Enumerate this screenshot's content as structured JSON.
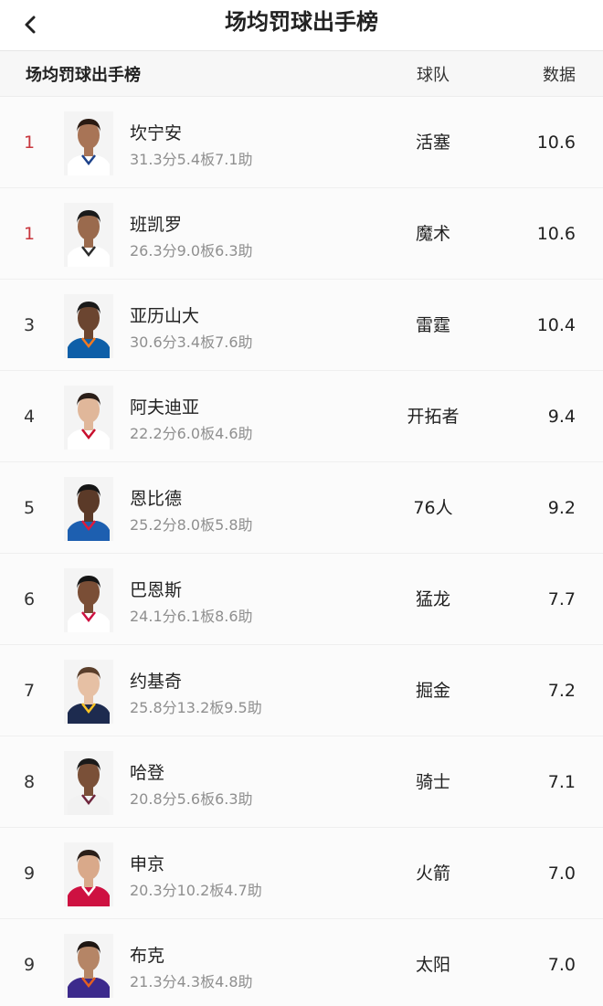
{
  "nav": {
    "title": "场均罚球出手榜"
  },
  "header": {
    "title": "场均罚球出手榜",
    "team_col": "球队",
    "data_col": "数据"
  },
  "accent_color": "#c8363d",
  "rows": [
    {
      "rank": "1",
      "name": "坎宁安",
      "stats": "31.3分5.4板7.1助",
      "team": "活塞",
      "value": "10.6",
      "jersey": "#ffffff",
      "trim": "#1d428a",
      "skin": "#a87456",
      "hair": "#2a1a12"
    },
    {
      "rank": "1",
      "name": "班凯罗",
      "stats": "26.3分9.0板6.3助",
      "team": "魔术",
      "value": "10.6",
      "jersey": "#ffffff",
      "trim": "#2b2b2b",
      "skin": "#9a6a4d",
      "hair": "#1a1a1a"
    },
    {
      "rank": "3",
      "name": "亚历山大",
      "stats": "30.6分3.4板7.6助",
      "team": "雷霆",
      "value": "10.4",
      "jersey": "#0e5fa8",
      "trim": "#f47a20",
      "skin": "#6b4530",
      "hair": "#1a1a1a"
    },
    {
      "rank": "4",
      "name": "阿夫迪亚",
      "stats": "22.2分6.0板4.6助",
      "team": "开拓者",
      "value": "9.4",
      "jersey": "#ffffff",
      "trim": "#c8102e",
      "skin": "#e0b79a",
      "hair": "#2a1e18"
    },
    {
      "rank": "5",
      "name": "恩比德",
      "stats": "25.2分8.0板5.8助",
      "team": "76人",
      "value": "9.2",
      "jersey": "#1d5fb0",
      "trim": "#e01a3c",
      "skin": "#5b3a28",
      "hair": "#151515"
    },
    {
      "rank": "6",
      "name": "巴恩斯",
      "stats": "24.1分6.1板8.6助",
      "team": "猛龙",
      "value": "7.7",
      "jersey": "#ffffff",
      "trim": "#ce1141",
      "skin": "#7a4e36",
      "hair": "#151515"
    },
    {
      "rank": "7",
      "name": "约基奇",
      "stats": "25.8分13.2板9.5助",
      "team": "掘金",
      "value": "7.2",
      "jersey": "#1d2b4f",
      "trim": "#fec524",
      "skin": "#e6c0a4",
      "hair": "#5a3e2a"
    },
    {
      "rank": "8",
      "name": "哈登",
      "stats": "20.8分5.6板6.3助",
      "team": "骑士",
      "value": "7.1",
      "jersey": "#f2f2f2",
      "trim": "#6f263d",
      "skin": "#7a5038",
      "hair": "#1a1a1a"
    },
    {
      "rank": "9",
      "name": "申京",
      "stats": "20.3分10.2板4.7助",
      "team": "火箭",
      "value": "7.0",
      "jersey": "#ce1141",
      "trim": "#ffffff",
      "skin": "#d9a98a",
      "hair": "#2a1e18"
    },
    {
      "rank": "9",
      "name": "布克",
      "stats": "21.3分4.3板4.8助",
      "team": "太阳",
      "value": "7.0",
      "jersey": "#3c2a8c",
      "trim": "#e56020",
      "skin": "#b58566",
      "hair": "#1e1612"
    }
  ]
}
